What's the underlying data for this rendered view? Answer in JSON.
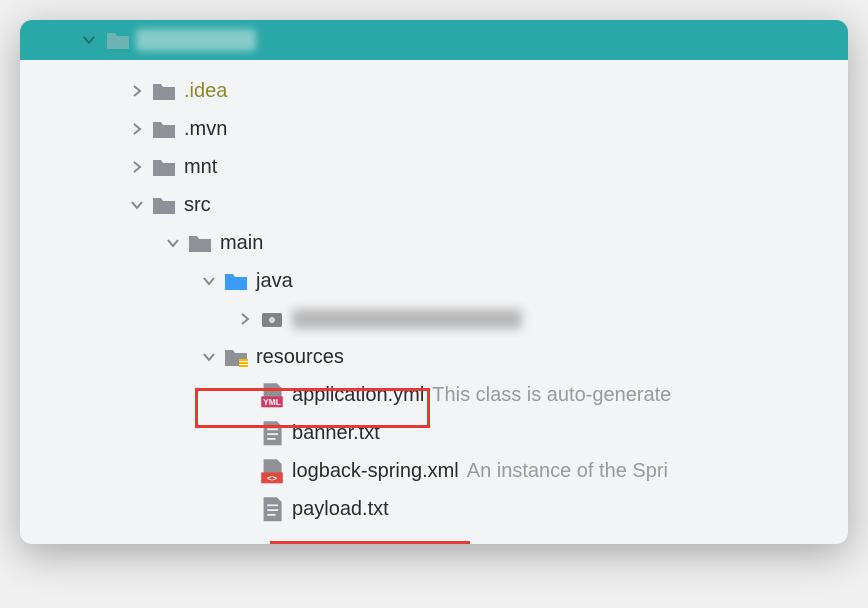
{
  "colors": {
    "titlebar": "#2aa7a7",
    "folder_gray": "#8e9196",
    "folder_blue": "#3b9cf5",
    "folder_bullet": "#7f8287",
    "red_box": "#e53935"
  },
  "tree": {
    "root": {
      "expanded": true
    },
    "idea": {
      "label": ".idea",
      "expanded": false
    },
    "mvn": {
      "label": ".mvn",
      "expanded": false
    },
    "mnt": {
      "label": "mnt",
      "expanded": false
    },
    "src": {
      "label": "src",
      "expanded": true
    },
    "main": {
      "label": "main",
      "expanded": true
    },
    "java": {
      "label": "java",
      "expanded": true
    },
    "pkg": {
      "expanded": false
    },
    "resources": {
      "label": "resources",
      "expanded": true
    },
    "files": {
      "app_yml": {
        "name": "application.yml",
        "hint": "This class is auto-generate"
      },
      "banner": {
        "name": "banner.txt"
      },
      "logback": {
        "name": "logback-spring.xml",
        "hint": "An instance of the Spri"
      },
      "payload": {
        "name": "payload.txt"
      }
    }
  }
}
